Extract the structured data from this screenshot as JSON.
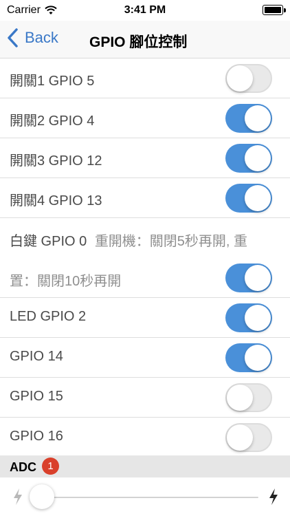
{
  "status_bar": {
    "carrier": "Carrier",
    "time": "3:41 PM"
  },
  "nav": {
    "back_label": "Back",
    "title": "GPIO 腳位控制"
  },
  "rows": [
    {
      "label": "開關1 GPIO 5",
      "on": false
    },
    {
      "label": "開關2 GPIO 4",
      "on": true
    },
    {
      "label": "開關3 GPIO 12",
      "on": true
    },
    {
      "label": "開關4 GPIO 13",
      "on": true
    }
  ],
  "white_key": {
    "label": "白鍵 GPIO 0",
    "desc_line1": "重開機：關閉5秒再開, 重",
    "desc_line2": "置：關閉10秒再開",
    "on": true
  },
  "rows2": [
    {
      "label": "LED GPIO 2",
      "on": true
    },
    {
      "label": "GPIO 14",
      "on": true
    },
    {
      "label": "GPIO 15",
      "on": false
    },
    {
      "label": "GPIO 16",
      "on": false
    }
  ],
  "adc": {
    "label": "ADC",
    "badge": "1",
    "slider_value": 0
  },
  "colors": {
    "accent": "#4a90d9",
    "back": "#3a78c7",
    "badge": "#d9402b"
  }
}
